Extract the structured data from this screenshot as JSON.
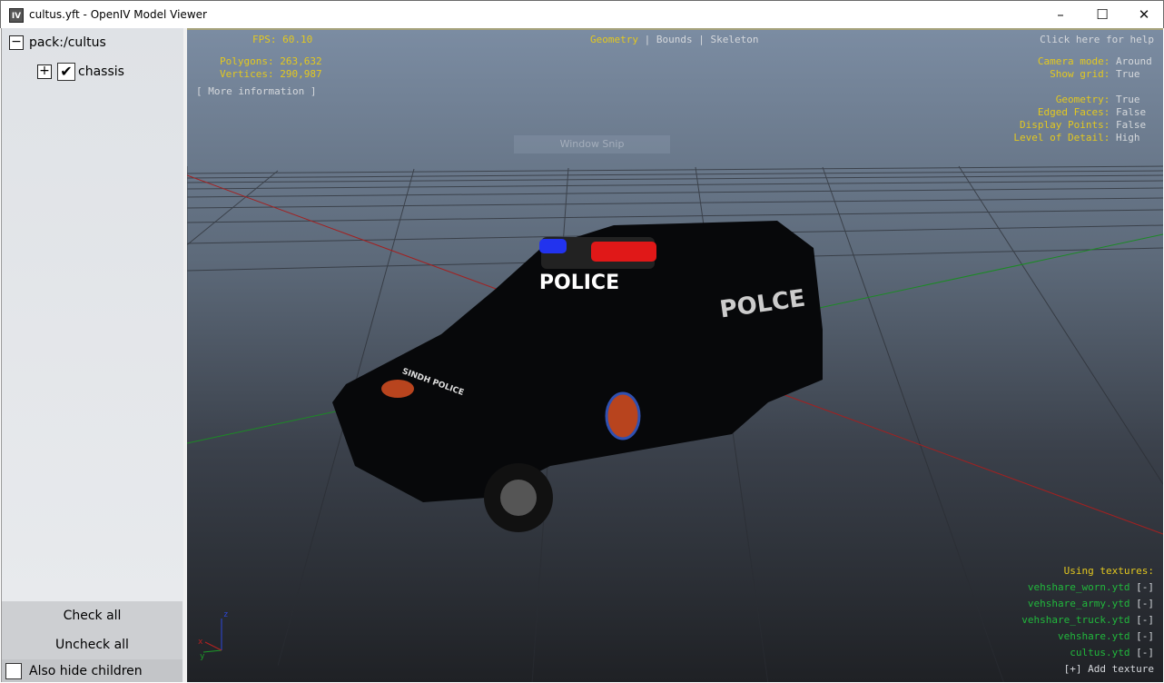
{
  "window": {
    "title": "cultus.yft - OpenIV Model Viewer",
    "icon": "IV"
  },
  "tree": {
    "root": "pack:/cultus",
    "child": "chassis",
    "child_checked": true
  },
  "left_panel": {
    "check_all": "Check all",
    "uncheck_all": "Uncheck all",
    "hide_children": "Also hide children"
  },
  "overlay": {
    "fps_label": "FPS:",
    "fps": "60.10",
    "polygons_label": "Polygons:",
    "polygons": "263,632",
    "vertices_label": "Vertices:",
    "vertices": "290,987",
    "more_info": "[ More information ]",
    "modes": [
      "Geometry",
      "Bounds",
      "Skeleton"
    ],
    "help": "Click here for help",
    "settings": [
      {
        "label": "Camera mode:",
        "value": "Around"
      },
      {
        "label": "Show grid:",
        "value": "True"
      },
      {
        "label": "Geometry:",
        "value": "True"
      },
      {
        "label": "Edged Faces:",
        "value": "False"
      },
      {
        "label": "Display Points:",
        "value": "False"
      },
      {
        "label": "Level of Detail:",
        "value": "High"
      }
    ],
    "textures_title": "Using textures:",
    "textures": [
      "vehshare_worn.ytd",
      "vehshare_army.ytd",
      "vehshare_truck.ytd",
      "vehshare.ytd",
      "cultus.ytd"
    ],
    "remove": "[-]",
    "add_texture": "[+] Add texture",
    "snip": "Window Snip"
  },
  "model": {
    "roof_text": "POLICE",
    "side_text": "POLCE",
    "hood_text": "SINDH POLICE"
  },
  "axes": {
    "z": "z",
    "x": "x",
    "y": "y"
  },
  "colors": {
    "yellow": "#e3c81f",
    "green": "#21b83c"
  }
}
